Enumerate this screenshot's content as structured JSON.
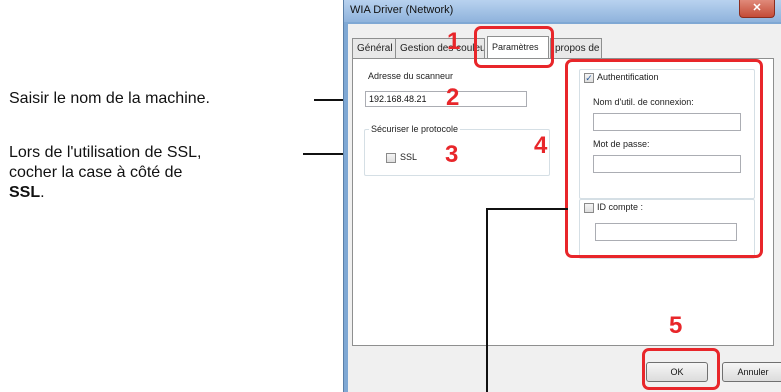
{
  "annotations": {
    "step2_text": "Saisir le nom de la machine.",
    "ssl_line1": "Lors de l'utilisation de SSL,",
    "ssl_line2": "cocher la case à côté de",
    "ssl_line3_bold": "SSL",
    "ssl_line3_end": "."
  },
  "window": {
    "title": "WIA Driver (Network)",
    "close_label": "✕"
  },
  "tabs": [
    {
      "label": "Général"
    },
    {
      "label": "Gestion des couleurs"
    },
    {
      "label": "Paramètres"
    },
    {
      "label": "propos de"
    }
  ],
  "scanner": {
    "address_label": "Adresse du scanneur",
    "address_value": "192.168.48.21"
  },
  "secure": {
    "group_label": "Sécuriser le protocole",
    "ssl_label": "SSL",
    "ssl_checked": false
  },
  "auth": {
    "label": "Authentification",
    "checked": true,
    "login_label": "Nom d'util. de connexion:",
    "login_value": "",
    "password_label": "Mot de passe:",
    "password_value": ""
  },
  "account": {
    "label": "ID compte :",
    "checked": false,
    "value": ""
  },
  "buttons": {
    "ok": "OK",
    "cancel": "Annuler"
  },
  "steps": {
    "s1": "1",
    "s2": "2",
    "s3": "3",
    "s4": "4",
    "s5": "5"
  },
  "colors": {
    "highlight": "#e8262a"
  }
}
